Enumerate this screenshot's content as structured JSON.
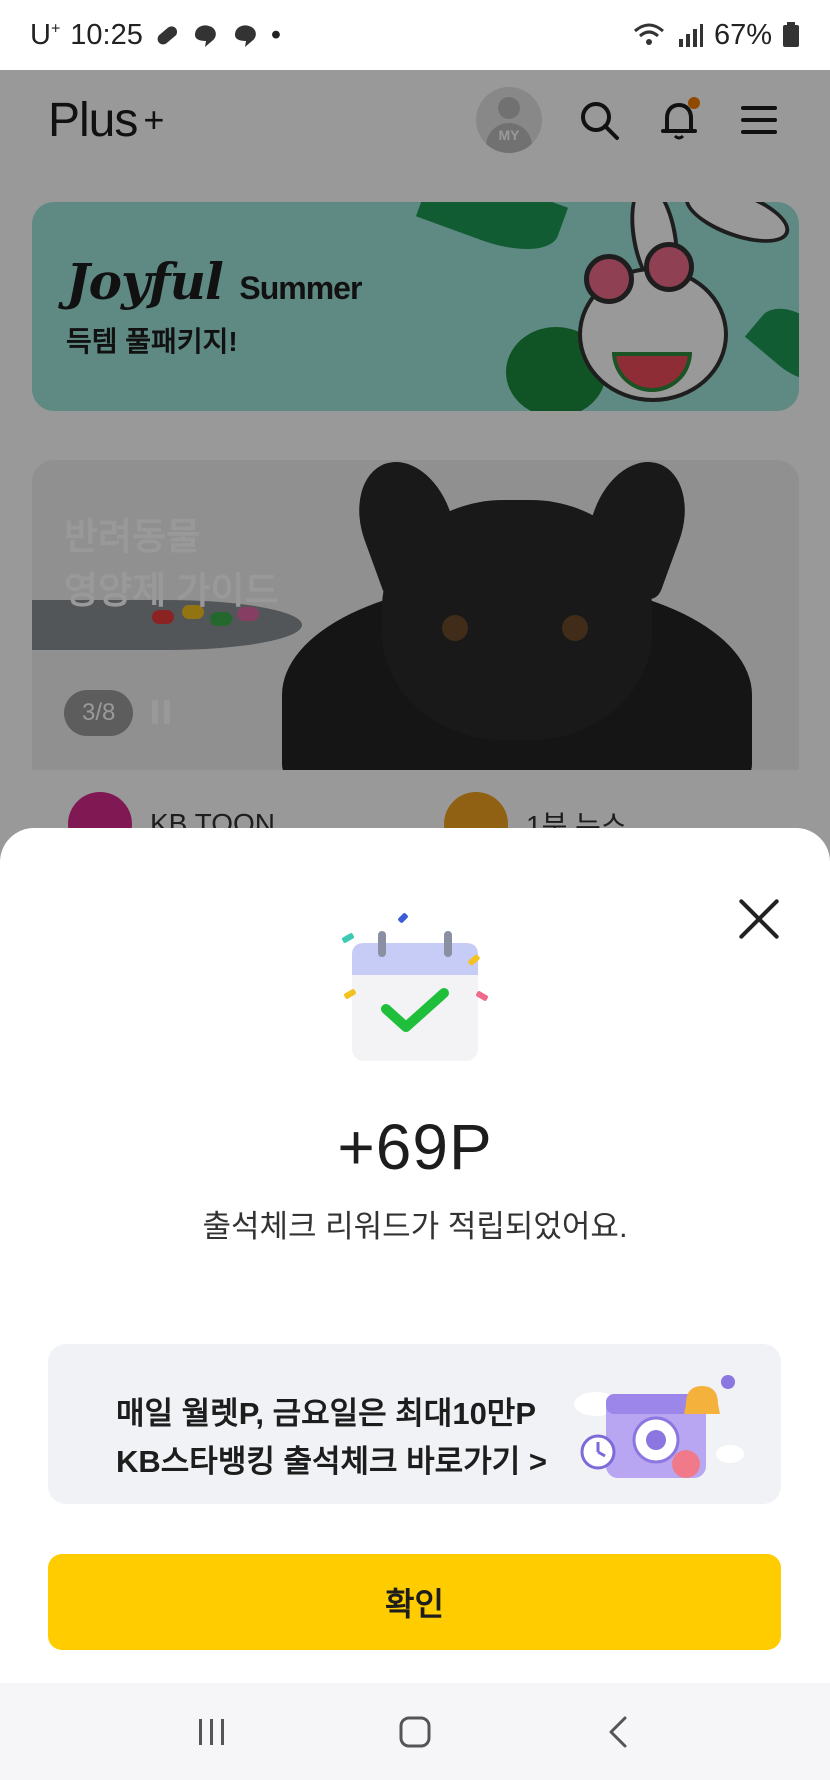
{
  "status_bar": {
    "carrier": "U",
    "carrier_sup": "+",
    "time": "10:25",
    "battery": "67%",
    "dot": "•"
  },
  "header": {
    "logo_text": "Plus",
    "logo_suffix": "+",
    "avatar_label": "MY",
    "notification_dot_color": "#f07b00"
  },
  "banners": {
    "summer": {
      "title": "Joyful",
      "title_small": "Summer",
      "subtitle": "득템 풀패키지!"
    },
    "pet": {
      "line1": "반려동물",
      "line2": "영양제 가이드",
      "counter": "3/8"
    }
  },
  "quick_links": [
    {
      "label": "KB TOON"
    },
    {
      "label": "1분 뉴스"
    }
  ],
  "sheet": {
    "points": "+69P",
    "description": "출석체크 리워드가 적립되었어요.",
    "promo_line1": "매일 월렛P, 금요일은 최대10만P",
    "promo_line2": "KB스타뱅킹 출석체크 바로가기 >",
    "confirm_label": "확인",
    "accent_color": "#ffcc00"
  },
  "nav": {
    "icons": [
      "recent-apps-icon",
      "home-icon",
      "back-icon"
    ]
  }
}
